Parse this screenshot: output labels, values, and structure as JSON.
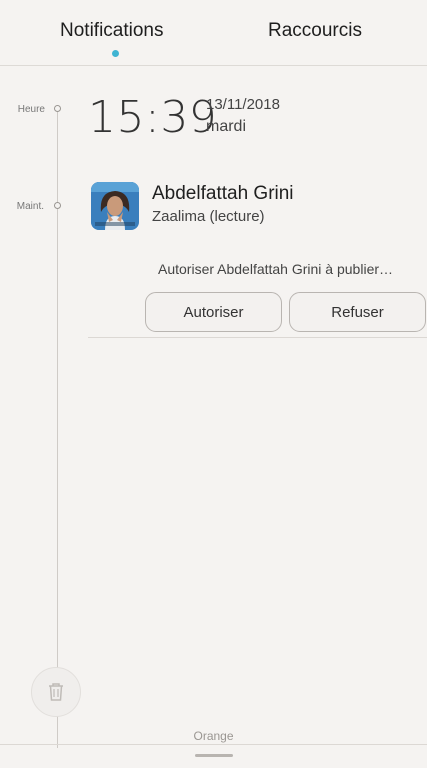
{
  "tabs": {
    "notifications": "Notifications",
    "raccourcis": "Raccourcis",
    "active": "notifications",
    "indicator_color": "#3fb4d2"
  },
  "timeline": {
    "heure_label": "Heure",
    "maint_label": "Maint."
  },
  "clock": {
    "time": "15:39",
    "date": "13/11/2018",
    "day": "mardi"
  },
  "notification": {
    "avatar_icon": "contact-photo",
    "title": "Abdelfattah Grini",
    "subtitle": "Zaalima (lecture)",
    "message": "Autoriser Abdelfattah Grini à publier…",
    "allow_label": "Autoriser",
    "deny_label": "Refuser"
  },
  "footer": {
    "carrier": "Orange",
    "trash_icon": "trash-icon"
  }
}
